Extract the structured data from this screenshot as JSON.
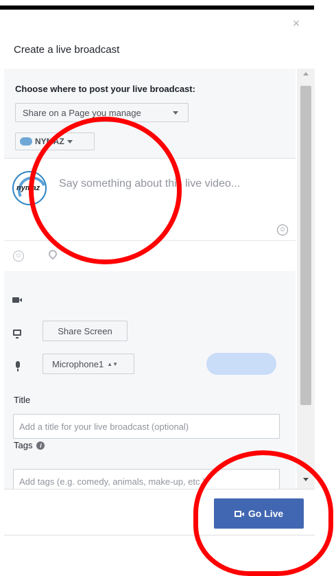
{
  "dialog": {
    "title": "Create a live broadcast",
    "close_glyph": "×"
  },
  "post_target": {
    "label": "Choose where to post your live broadcast:",
    "share_select_value": "Share on a Page you manage",
    "page_select_value": "NYMAZ"
  },
  "composer": {
    "avatar_text": "nymaz",
    "placeholder": "Say something about this live video..."
  },
  "icons": {
    "emoji": "emoji-icon",
    "location": "location-pin-icon",
    "camera": "video-camera-icon",
    "screen": "monitor-icon",
    "mic": "microphone-icon",
    "info": "info-icon"
  },
  "media": {
    "share_screen_label": "Share Screen",
    "microphone_value": "Microphone1",
    "level_bar_color": "#c9dcf8"
  },
  "form": {
    "title_label": "Title",
    "title_placeholder": "Add a title for your live broadcast (optional)",
    "tags_label": "Tags",
    "tags_placeholder": "Add tags (e.g. comedy, animals, make-up, etc.)"
  },
  "footer": {
    "go_live_label": "Go Live"
  },
  "colors": {
    "primary_button": "#4267b2",
    "annotation": "#ff0000"
  }
}
